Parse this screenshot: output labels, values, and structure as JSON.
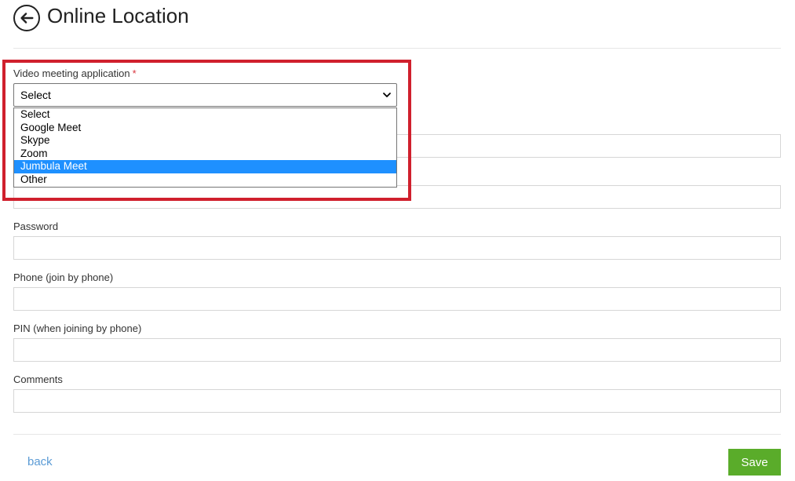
{
  "header": {
    "title": "Online Location",
    "back_icon": "arrow-left-icon"
  },
  "form": {
    "video_app": {
      "label": "Video meeting application",
      "required_mark": "*",
      "selected": "Select",
      "options": [
        "Select",
        "Google Meet",
        "Skype",
        "Zoom",
        "Jumbula Meet",
        "Other"
      ],
      "highlighted_option": "Jumbula Meet"
    },
    "password": {
      "label": "Password",
      "value": ""
    },
    "phone": {
      "label": "Phone (join by phone)",
      "value": ""
    },
    "pin": {
      "label": "PIN (when joining by phone)",
      "value": ""
    },
    "comments": {
      "label": "Comments",
      "value": ""
    }
  },
  "footer": {
    "back_label": "back",
    "save_label": "Save"
  },
  "colors": {
    "highlight_frame": "#d0202d",
    "option_highlight": "#1e90ff",
    "save_button": "#5aac2a",
    "link": "#5b9bd5"
  }
}
